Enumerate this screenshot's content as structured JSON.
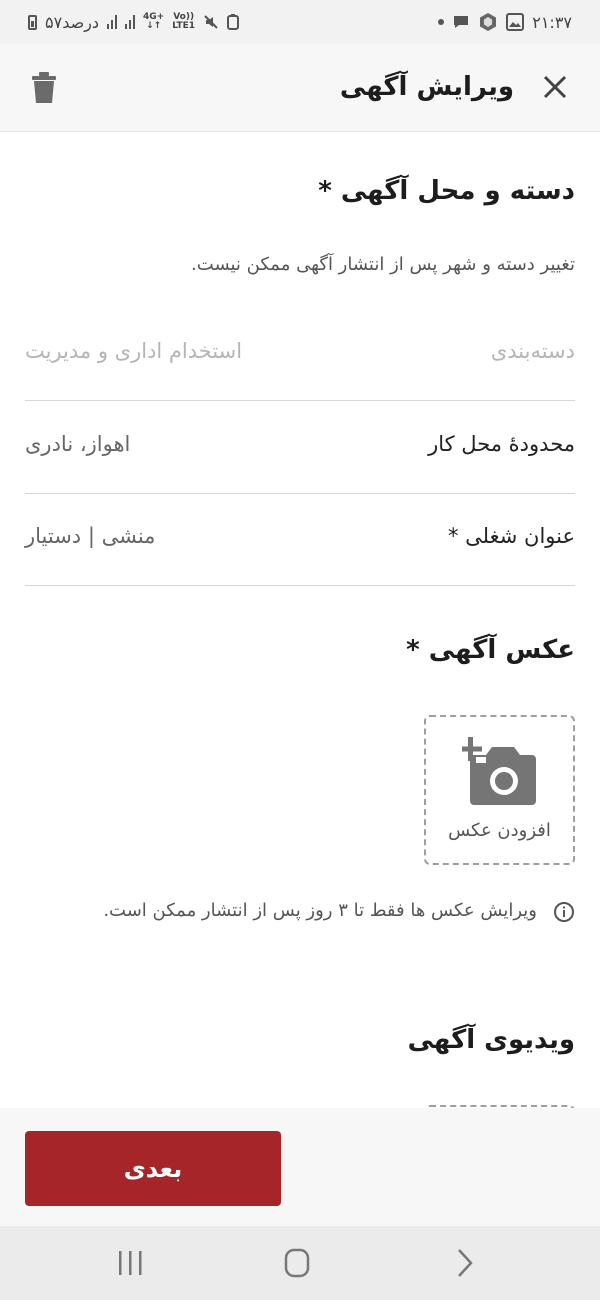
{
  "status_bar": {
    "time": "۲۱:۳۷",
    "battery_text": "۵۷درصد",
    "network_top": "4G+",
    "network_bottom": "LTE1",
    "volte_top": "Vo))",
    "volte_bottom": "LTE1"
  },
  "header": {
    "title": "ویرایش آگهی"
  },
  "category_section": {
    "title": "دسته و محل آگهی *",
    "hint": "تغییر دسته و شهر پس از انتشار آگهی ممکن نیست.",
    "rows": [
      {
        "label": "دسته‌بندی",
        "value": "استخدام اداری و مدیریت",
        "disabled": true
      },
      {
        "label": "محدودهٔ محل کار",
        "value": "اهواز، نادری",
        "disabled": false
      },
      {
        "label": "عنوان شغلی *",
        "value": "منشی | دستیار",
        "disabled": false
      }
    ]
  },
  "photo_section": {
    "title": "عکس آگهی *",
    "add_label": "افزودن عکس",
    "info": "ویرایش عکس ها فقط تا ۳ روز پس از انتشار ممکن است."
  },
  "video_section": {
    "title": "ویدیوی آگهی"
  },
  "footer": {
    "next_label": "بعدی"
  },
  "colors": {
    "accent": "#a62528",
    "text": "#1d1d1d",
    "muted": "#b5b5b5",
    "icon": "#757575"
  }
}
